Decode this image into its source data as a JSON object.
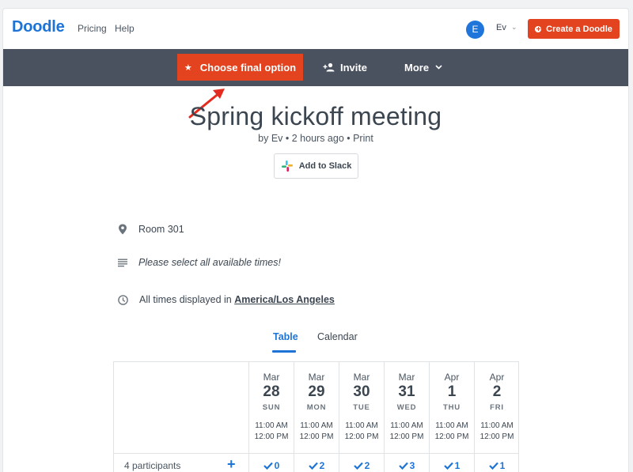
{
  "header": {
    "logo": "Doodle",
    "nav": {
      "pricing": "Pricing",
      "help": "Help"
    },
    "user": {
      "avatar_initial": "E",
      "name": "Ev",
      "chevron": "⌄"
    },
    "create_button": "Create a Doodle"
  },
  "toolbar": {
    "choose_final": "Choose final option",
    "invite": "Invite",
    "more": "More"
  },
  "poll": {
    "title": "Spring kickoff meeting",
    "byline": "by Ev • 2 hours ago • Print",
    "slack_button": "Add to Slack",
    "location": "Room 301",
    "description": "Please select all available times!",
    "timezone_prefix": "All times displayed in",
    "timezone": "America/Los Angeles"
  },
  "tabs": {
    "table": "Table",
    "calendar": "Calendar"
  },
  "table": {
    "participants_label": "4 participants",
    "add_symbol": "+",
    "columns": [
      {
        "month": "Mar",
        "day": "28",
        "dow": "SUN",
        "start": "11:00 AM",
        "end": "12:00 PM",
        "count": "0"
      },
      {
        "month": "Mar",
        "day": "29",
        "dow": "MON",
        "start": "11:00 AM",
        "end": "12:00 PM",
        "count": "2"
      },
      {
        "month": "Mar",
        "day": "30",
        "dow": "TUE",
        "start": "11:00 AM",
        "end": "12:00 PM",
        "count": "2"
      },
      {
        "month": "Mar",
        "day": "31",
        "dow": "WED",
        "start": "11:00 AM",
        "end": "12:00 PM",
        "count": "3"
      },
      {
        "month": "Apr",
        "day": "1",
        "dow": "THU",
        "start": "11:00 AM",
        "end": "12:00 PM",
        "count": "1"
      },
      {
        "month": "Apr",
        "day": "2",
        "dow": "FRI",
        "start": "11:00 AM",
        "end": "12:00 PM",
        "count": "1"
      }
    ]
  },
  "colors": {
    "brand_blue": "#1d73d6",
    "accent_orange": "#e3431f",
    "toolbar_gray": "#4a5260",
    "arrow_red": "#e32b1f"
  },
  "icons": {
    "create": "plus-circle-icon",
    "final": "star-icon",
    "invite": "add-person-icon",
    "more": "chevron-down-icon",
    "slack": "slack-icon",
    "location": "map-pin-icon",
    "description": "text-lines-icon",
    "timezone": "clock-icon",
    "check": "check-icon"
  }
}
